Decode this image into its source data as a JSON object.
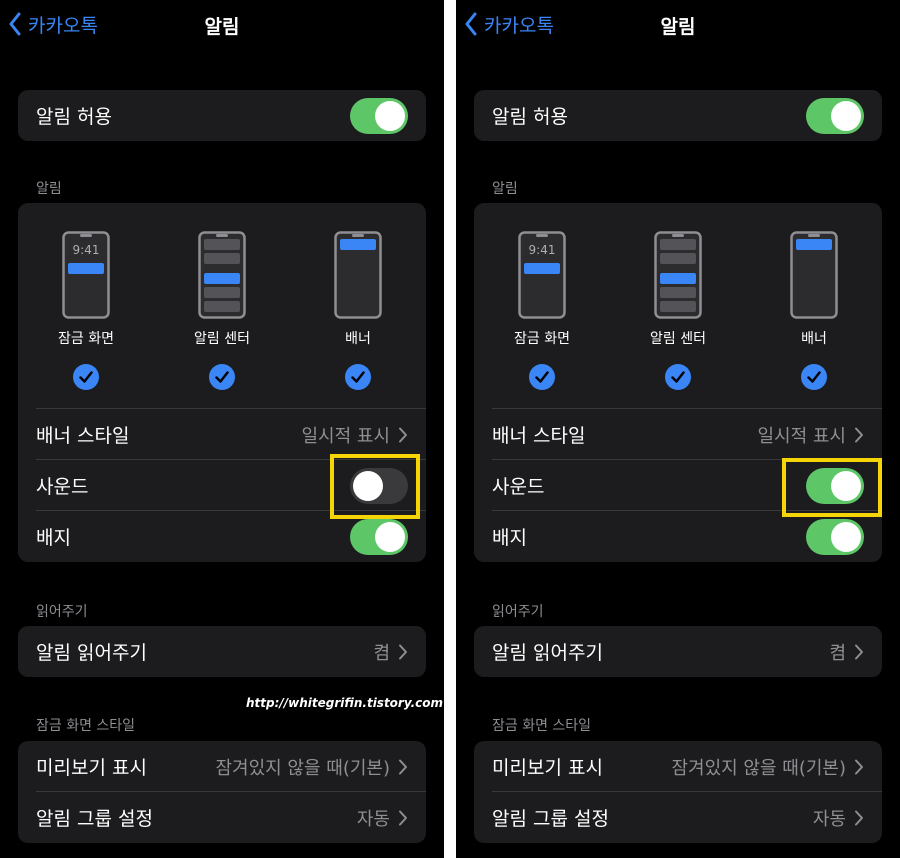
{
  "panels": [
    {
      "nav": {
        "back_label": "카카오톡",
        "title": "알림"
      },
      "allow": {
        "label": "알림 허용",
        "on": true
      },
      "alerts": {
        "header": "알림",
        "styles": [
          {
            "label": "잠금 화면",
            "time": "9:41",
            "checked": true
          },
          {
            "label": "알림 센터",
            "checked": true
          },
          {
            "label": "배너",
            "checked": true
          }
        ],
        "banner_style": {
          "label": "배너 스타일",
          "value": "일시적 표시"
        },
        "sound": {
          "label": "사운드",
          "on": false
        },
        "badge": {
          "label": "배지",
          "on": true
        }
      },
      "announce": {
        "header": "읽어주기",
        "label": "알림 읽어주기",
        "value": "켬"
      },
      "lock_screen": {
        "header": "잠금 화면 스타일",
        "preview": {
          "label": "미리보기 표시",
          "value": "잠겨있지 않을 때(기본)"
        },
        "grouping": {
          "label": "알림 그룹 설정",
          "value": "자동"
        }
      },
      "watermark": "http://whitegrifin.tistory.com"
    },
    {
      "nav": {
        "back_label": "카카오톡",
        "title": "알림"
      },
      "allow": {
        "label": "알림 허용",
        "on": true
      },
      "alerts": {
        "header": "알림",
        "styles": [
          {
            "label": "잠금 화면",
            "time": "9:41",
            "checked": true
          },
          {
            "label": "알림 센터",
            "checked": true
          },
          {
            "label": "배너",
            "checked": true
          }
        ],
        "banner_style": {
          "label": "배너 스타일",
          "value": "일시적 표시"
        },
        "sound": {
          "label": "사운드",
          "on": true
        },
        "badge": {
          "label": "배지",
          "on": true
        }
      },
      "announce": {
        "header": "읽어주기",
        "label": "알림 읽어주기",
        "value": "켬"
      },
      "lock_screen": {
        "header": "잠금 화면 스타일",
        "preview": {
          "label": "미리보기 표시",
          "value": "잠겨있지 않을 때(기본)"
        },
        "grouping": {
          "label": "알림 그룹 설정",
          "value": "자동"
        }
      }
    }
  ],
  "colors": {
    "accent": "#3a86f7",
    "toggle_on": "#5dc768",
    "toggle_off": "#3a3a3c",
    "highlight": "#f5d506",
    "cell_bg": "#1c1c1e"
  },
  "icons": [
    "chevron-left-icon",
    "chevron-right-icon",
    "check-circle-icon",
    "phone-icon"
  ]
}
